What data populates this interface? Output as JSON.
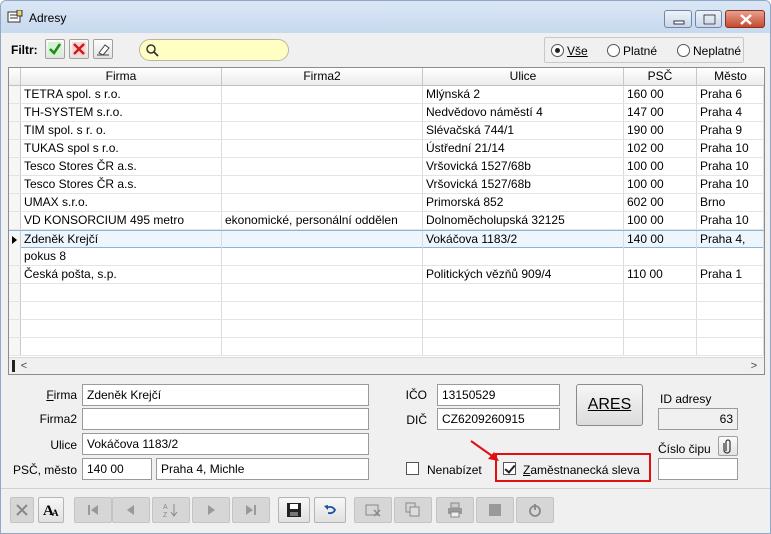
{
  "window": {
    "title": "Adresy"
  },
  "filter": {
    "label": "Filtr:",
    "search_value": "",
    "radios": [
      {
        "label": "Vše",
        "selected": true
      },
      {
        "label": "Platné",
        "selected": false
      },
      {
        "label": "Neplatné",
        "selected": false
      }
    ]
  },
  "grid": {
    "columns": [
      "Firma",
      "Firma2",
      "Ulice",
      "PSČ",
      "Město"
    ],
    "rows": [
      {
        "firma": "TETRA spol. s r.o.",
        "firma2": "",
        "ulice": "Mlýnská 2",
        "psc": "160 00",
        "mesto": "Praha 6"
      },
      {
        "firma": "TH-SYSTEM s.r.o.",
        "firma2": "",
        "ulice": "Nedvědovo náměstí 4",
        "psc": "147 00",
        "mesto": "Praha 4"
      },
      {
        "firma": "TIM spol. s r. o.",
        "firma2": "",
        "ulice": "Slévačská 744/1",
        "psc": "190 00",
        "mesto": "Praha 9"
      },
      {
        "firma": "TUKAS spol s r.o.",
        "firma2": "",
        "ulice": "Ústřední 21/14",
        "psc": "102 00",
        "mesto": "Praha 10"
      },
      {
        "firma": "Tesco Stores ČR a.s.",
        "firma2": "",
        "ulice": "Vršovická 1527/68b",
        "psc": "100 00",
        "mesto": "Praha 10"
      },
      {
        "firma": "Tesco Stores ČR a.s.",
        "firma2": "",
        "ulice": "Vršovická 1527/68b",
        "psc": "100 00",
        "mesto": "Praha 10"
      },
      {
        "firma": "UMAX s.r.o.",
        "firma2": "",
        "ulice": "Primorská 852",
        "psc": "602 00",
        "mesto": "Brno"
      },
      {
        "firma": "VD KONSORCIUM 495 metro",
        "firma2": "ekonomické, personální oddělen",
        "ulice": "Dolnoměcholupská 32125",
        "psc": "100 00",
        "mesto": "Praha 10"
      },
      {
        "firma": "Zdeněk Krejčí",
        "firma2": "",
        "ulice": "Vokáčova 1183/2",
        "psc": "140 00",
        "mesto": "Praha 4,",
        "selected": true
      },
      {
        "firma": "pokus 8",
        "firma2": "",
        "ulice": "",
        "psc": "",
        "mesto": ""
      },
      {
        "firma": "Česká pošta, s.p.",
        "firma2": "",
        "ulice": "Politických vězňů 909/4",
        "psc": "110 00",
        "mesto": "Praha 1"
      },
      {
        "firma": "",
        "firma2": "",
        "ulice": "",
        "psc": "",
        "mesto": ""
      },
      {
        "firma": "",
        "firma2": "",
        "ulice": "",
        "psc": "",
        "mesto": ""
      },
      {
        "firma": "",
        "firma2": "",
        "ulice": "",
        "psc": "",
        "mesto": ""
      },
      {
        "firma": "",
        "firma2": "",
        "ulice": "",
        "psc": "",
        "mesto": ""
      }
    ]
  },
  "form": {
    "firma_label": "Firma",
    "firma_value": "Zdeněk Krejčí",
    "firma2_label": "Firma2",
    "firma2_value": "",
    "ulice_label": "Ulice",
    "ulice_value": "Vokáčova 1183/2",
    "psc_mesto_label": "PSČ, město",
    "psc_value": "140 00",
    "mesto_value": "Praha 4, Michle",
    "ico_label": "IČO",
    "ico_value": "13150529",
    "dic_label": "DIČ",
    "dic_value": "CZ6209260915",
    "ares_label": "ARES",
    "id_label": "ID adresy",
    "id_value": "63",
    "cislo_cipu_label": "Číslo čipu",
    "cislo_cipu_value": "",
    "nenabizet_label": "Nenabízet",
    "nenabizet_checked": false,
    "sleva_label": "Zaměstnanecká sleva",
    "sleva_checked": true
  },
  "colors": {
    "highlight": "#e01010",
    "search_bg": "#ffffc4",
    "selected_row": "#eef6fd"
  }
}
